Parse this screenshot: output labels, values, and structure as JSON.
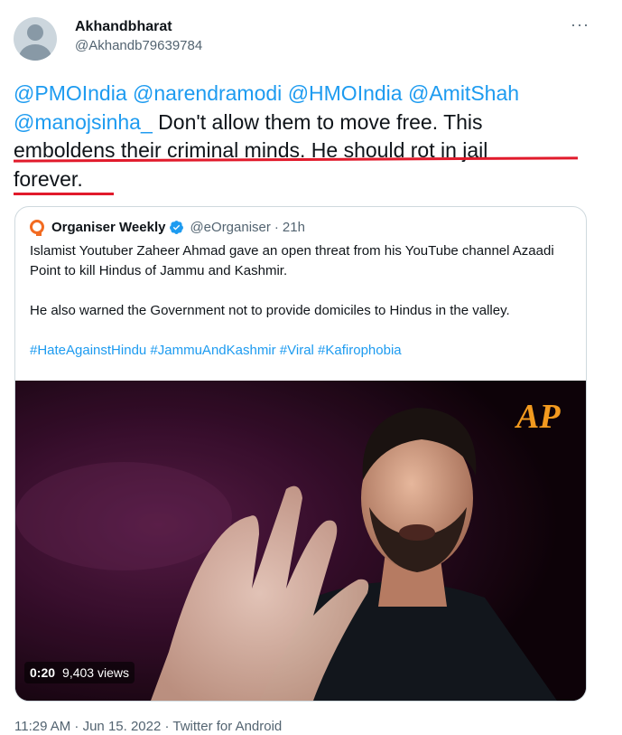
{
  "author": {
    "name": "Akhandbharat",
    "handle": "@Akhandb79639784"
  },
  "tweet": {
    "mentions": [
      "@PMOIndia",
      "@narendramodi",
      "@HMOIndia",
      "@AmitShah",
      "@manojsinha_"
    ],
    "text_part1": "Don't allow them to move free. This",
    "text_part2": "emboldens their criminal minds. He should rot in jail",
    "text_part3": "forever."
  },
  "quote": {
    "name": "Organiser Weekly",
    "handle": "@eOrganiser",
    "separator": "·",
    "time": "21h",
    "paragraph1": "Islamist Youtuber Zaheer Ahmad gave an open threat from his YouTube channel Azaadi Point to kill Hindus of Jammu and Kashmir.",
    "paragraph2": "He also warned the Government not to provide domiciles to Hindus in the valley.",
    "hashtags": "#HateAgainstHindu #JammuAndKashmir #Viral #Kafirophobia",
    "video": {
      "duration": "0:20",
      "views": "9,403 views",
      "logo_text": "AP"
    }
  },
  "footer": {
    "text": "11:29 AM · Jun 15. 2022 · Twitter for Android"
  },
  "colors": {
    "mention_blue": "#1d9bf0",
    "annotation_red": "#e11a2b",
    "organiser_orange": "#f26b21"
  },
  "icons": [
    "more-icon",
    "avatar",
    "organiser-logo",
    "verified-badge-icon"
  ]
}
